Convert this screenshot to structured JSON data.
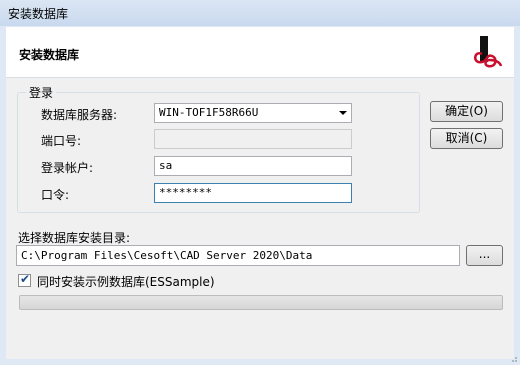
{
  "window": {
    "title": "安装数据库"
  },
  "header": {
    "title": "安装数据库",
    "logo_icon": "cesoft-logo-icon",
    "logo_color": "#c8102e"
  },
  "login_group": {
    "legend": "登录",
    "server_label": "数据库服务器:",
    "server_value": "WIN-TOF1F58R66U",
    "port_label": "端口号:",
    "port_value": "",
    "account_label": "登录帐户:",
    "account_value": "sa",
    "password_label": "口令:",
    "password_value": "********"
  },
  "buttons": {
    "ok": "确定(O)",
    "cancel": "取消(C)",
    "browse": "..."
  },
  "install_dir": {
    "label": "选择数据库安装目录:",
    "value": "C:\\Program Files\\Cesoft\\CAD Server 2020\\Data"
  },
  "sample_checkbox": {
    "label": "同时安装示例数据库(ESSample)",
    "checked": true
  },
  "progress": {
    "value": 0
  }
}
